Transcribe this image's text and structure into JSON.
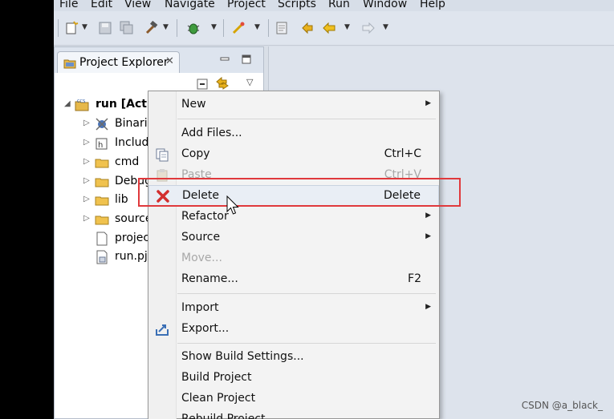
{
  "menubar": {
    "items": [
      "File",
      "Edit",
      "View",
      "Navigate",
      "Project",
      "Scripts",
      "Run",
      "Window",
      "Help"
    ]
  },
  "explorer": {
    "tab_label": "Project Explorer",
    "close_glyph": "✕",
    "tree": [
      {
        "label": "run  [Act",
        "icon": "ccs-project-icon",
        "expanded": true
      },
      {
        "label": "Binari",
        "icon": "binaries-icon"
      },
      {
        "label": "Includ",
        "icon": "includes-icon"
      },
      {
        "label": "cmd",
        "icon": "folder-icon"
      },
      {
        "label": "Debug",
        "icon": "folder-icon"
      },
      {
        "label": "lib",
        "icon": "folder-icon"
      },
      {
        "label": "source",
        "icon": "folder-icon"
      },
      {
        "label": "projec",
        "icon": "file-icon"
      },
      {
        "label": "run.pj",
        "icon": "pjt-file-icon"
      }
    ]
  },
  "context_menu": {
    "items": [
      {
        "label": "New",
        "submenu": true
      },
      {
        "label": "Add Files..."
      },
      {
        "label": "Copy",
        "shortcut": "Ctrl+C",
        "icon": "copy-icon"
      },
      {
        "label": "Paste",
        "shortcut": "Ctrl+V",
        "disabled": true,
        "icon": "paste-icon"
      },
      {
        "label": "Delete",
        "shortcut": "Delete",
        "icon": "delete-icon",
        "highlighted": true
      },
      {
        "label": "Refactor",
        "submenu": true
      },
      {
        "label": "Source",
        "submenu": true
      },
      {
        "label": "Move...",
        "disabled": true
      },
      {
        "label": "Rename...",
        "shortcut": "F2"
      },
      {
        "label": "Import",
        "submenu": true
      },
      {
        "label": "Export...",
        "icon": "export-icon"
      },
      {
        "label": "Show Build Settings..."
      },
      {
        "label": "Build Project"
      },
      {
        "label": "Clean Project"
      },
      {
        "label": "Rebuild Project"
      }
    ]
  },
  "watermark": "CSDN @a_black_",
  "colors": {
    "highlight_border": "#e0393c",
    "delete_icon": "#d22f2f"
  }
}
